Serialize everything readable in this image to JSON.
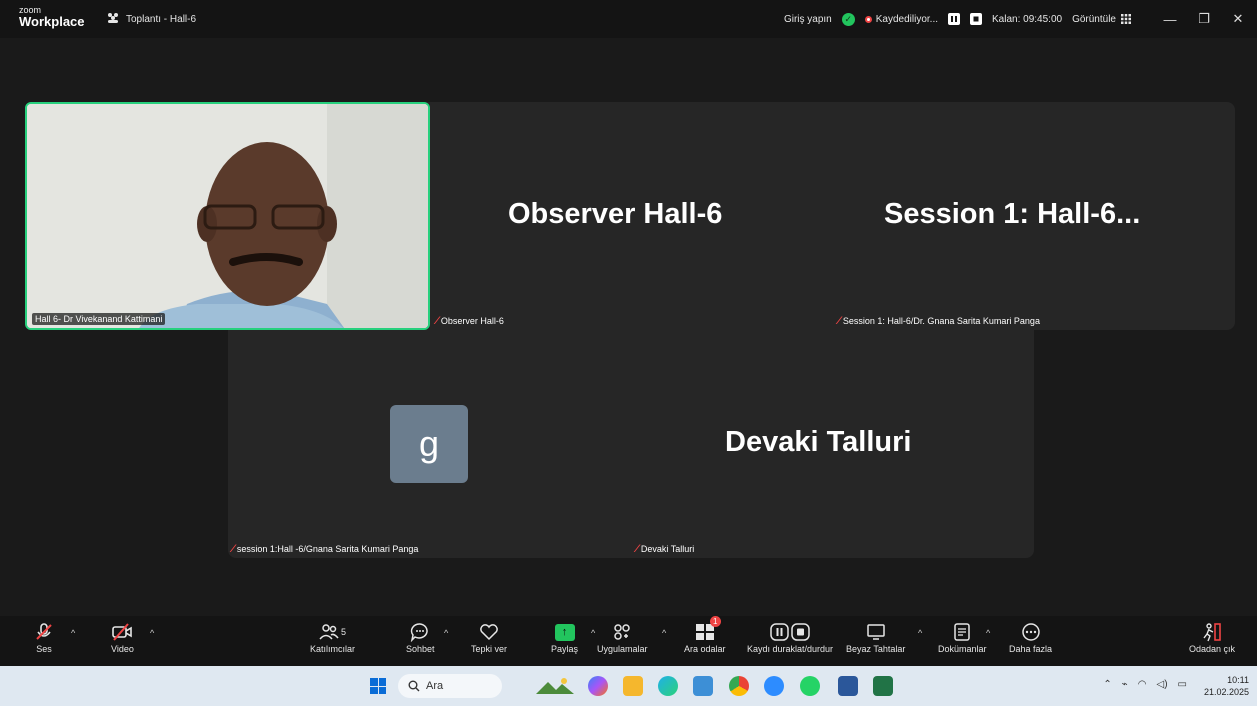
{
  "titlebar": {
    "brand_top": "zoom",
    "brand_bottom": "Workplace",
    "meeting_title": "Toplantı - Hall-6",
    "sign_in": "Giriş yapın",
    "recording": "Kaydediliyor...",
    "remaining": "Kalan: 09:45:00",
    "view": "Görüntüle"
  },
  "tiles": {
    "video_label": "Hall 6- Dr Vivekanand Kattimani",
    "observer_name": "Observer Hall-6",
    "observer_label": "Observer Hall-6",
    "session_name": "Session 1: Hall-6...",
    "session_label": "Session 1: Hall-6/Dr. Gnana Sarita Kumari Panga",
    "g_avatar": "g",
    "g_label": "session 1:Hall -6/Gnana Sarita Kumari Panga",
    "devaki_name": "Devaki Talluri",
    "devaki_label": "Devaki Talluri"
  },
  "toolbar": {
    "audio": "Ses",
    "video": "Video",
    "participants": "Katılımcılar",
    "participants_count": "5",
    "chat": "Sohbet",
    "react": "Tepki ver",
    "share": "Paylaş",
    "apps": "Uygulamalar",
    "breakout": "Ara odalar",
    "breakout_badge": "1",
    "record": "Kaydı duraklat/durdur",
    "whiteboards": "Beyaz Tahtalar",
    "docs": "Dokümanlar",
    "more": "Daha fazla",
    "leave": "Odadan çık"
  },
  "taskbar": {
    "search_placeholder": "Ara",
    "time": "10:11",
    "date": "21.02.2025"
  }
}
